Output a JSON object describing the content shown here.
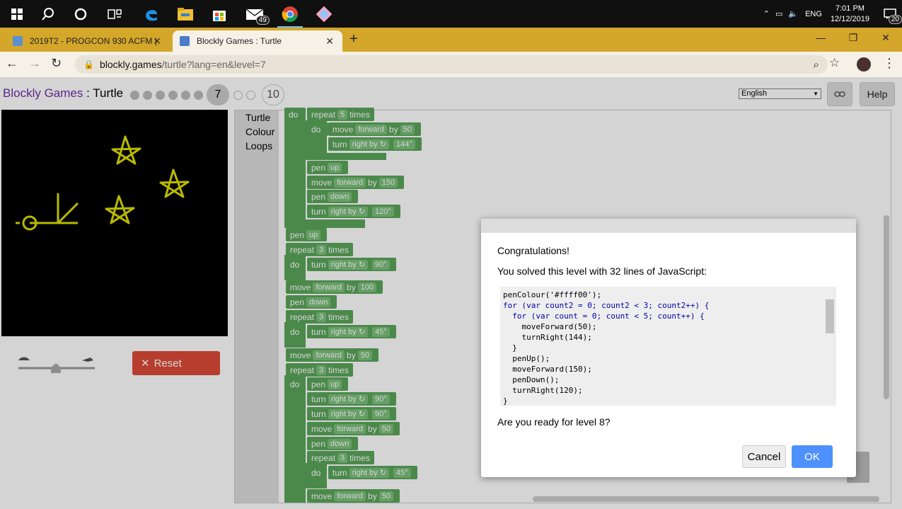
{
  "taskbar": {
    "mail_badge": "49",
    "lang": "ENG",
    "time": "7:01 PM",
    "date": "12/12/2019",
    "notif_badge": "20"
  },
  "browser": {
    "tabs": [
      {
        "label": "2019T2 - PROGCON 930 ACFM |"
      },
      {
        "label": "Blockly Games : Turtle"
      }
    ],
    "url_host": "blockly.games",
    "url_path": "/turtle?lang=en&level=7"
  },
  "page": {
    "title_link": "Blockly Games",
    "title_sep": " : ",
    "title_app": "Turtle",
    "current_level": "7",
    "last_level": "10",
    "language": "English",
    "help_label": "Help",
    "reset_label": "Reset",
    "toolbox": [
      "Turtle",
      "Colour",
      "Loops"
    ]
  },
  "blocks": {
    "do": "do",
    "repeat": "repeat",
    "times": "times",
    "move": "move",
    "forward": "forward",
    "by": "by",
    "turn": "turn",
    "right_by": "right by ↻",
    "pen": "pen",
    "up": "up",
    "down": "down",
    "n5": "5",
    "n3": "3",
    "n50": "50",
    "n150": "150",
    "n100": "100",
    "a144": "144°",
    "a120": "120°",
    "a90": "90°",
    "a45": "45°"
  },
  "dialog": {
    "heading": "Congratulations!",
    "message": "You solved this level with 32 lines of JavaScript:",
    "code": [
      "penColour('#ffff00');",
      "for (var count2 = 0; count2 < 3; count2++) {",
      "  for (var count = 0; count < 5; count++) {",
      "    moveForward(50);",
      "    turnRight(144);",
      "  }",
      "  penUp();",
      "  moveForward(150);",
      "  penDown();",
      "  turnRight(120);",
      "}"
    ],
    "question": "Are you ready for level 8?",
    "cancel_label": "Cancel",
    "ok_label": "OK"
  }
}
